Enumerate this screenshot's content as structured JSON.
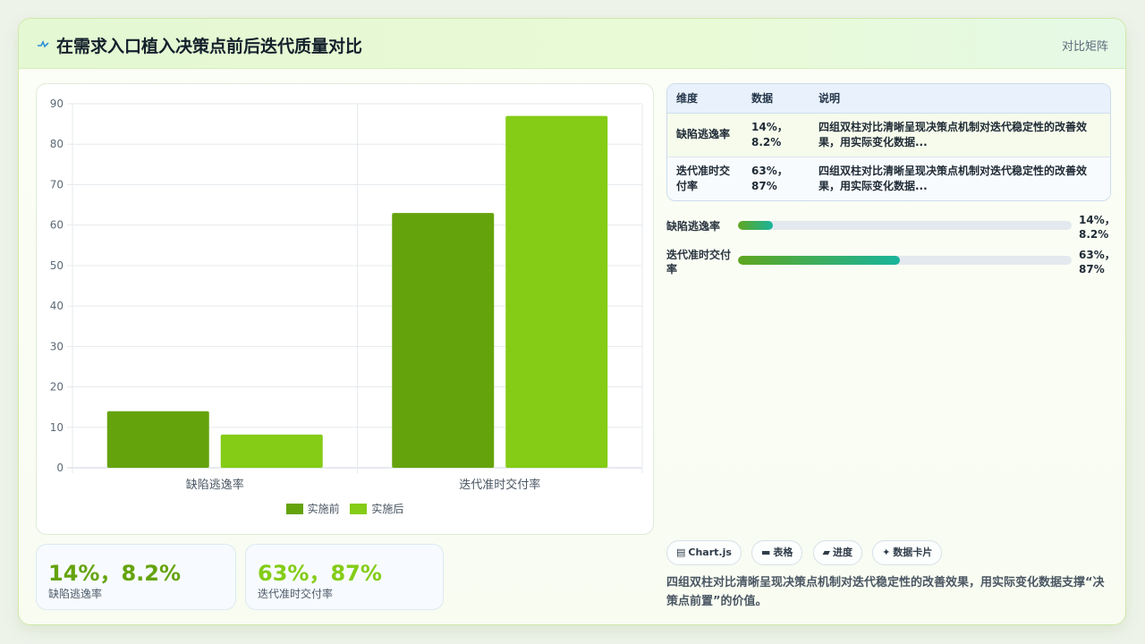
{
  "header": {
    "icon": "pulse-icon",
    "title": "在需求入口植入决策点前后迭代质量对比",
    "tag": "对比矩阵"
  },
  "colors": {
    "before": "#65a30d",
    "after": "#84cc16",
    "accent_teal": "#19b49c"
  },
  "chart_data": {
    "type": "bar",
    "categories": [
      "缺陷逃逸率",
      "迭代准时交付率"
    ],
    "series": [
      {
        "name": "实施前",
        "values": [
          14,
          63
        ]
      },
      {
        "name": "实施后",
        "values": [
          8.2,
          87
        ]
      }
    ],
    "ylim": [
      0,
      90
    ],
    "yticks": [
      "0",
      "10",
      "20",
      "30",
      "40",
      "50",
      "60",
      "70",
      "80",
      "90"
    ],
    "grid": true,
    "legend": "bottom"
  },
  "stats": [
    {
      "value": "14%，8.2%",
      "label": "缺陷逃逸率",
      "color": "#65a30d"
    },
    {
      "value": "63%，87%",
      "label": "迭代准时交付率",
      "color": "#84cc16"
    }
  ],
  "table": {
    "headers": [
      "维度",
      "数据",
      "说明"
    ],
    "rows": [
      {
        "dim": "缺陷逃逸率",
        "data": "14%，8.2%",
        "note": "四组双柱对比清晰呈现决策点机制对迭代稳定性的改善效果，用实际变化数据..."
      },
      {
        "dim": "迭代准时交付率",
        "data": "63%，87%",
        "note": "四组双柱对比清晰呈现决策点机制对迭代稳定性的改善效果，用实际变化数据..."
      }
    ]
  },
  "progress": [
    {
      "label": "缺陷逃逸率",
      "value_text": "14%，8.2%",
      "level": 0.105
    },
    {
      "label": "迭代准时交付率",
      "value_text": "63%，87%",
      "level": 0.485
    }
  ],
  "chips": [
    {
      "icon": "chart-icon",
      "glyph": "▤",
      "label": "Chart.js"
    },
    {
      "icon": "table-icon",
      "glyph": "▬",
      "label": "表格"
    },
    {
      "icon": "progress-icon",
      "glyph": "▰",
      "label": "进度"
    },
    {
      "icon": "sparkle-icon",
      "glyph": "✦",
      "label": "数据卡片"
    }
  ],
  "description": "四组双柱对比清晰呈现决策点机制对迭代稳定性的改善效果，用实际变化数据支撑“决策点前置”的价值。"
}
